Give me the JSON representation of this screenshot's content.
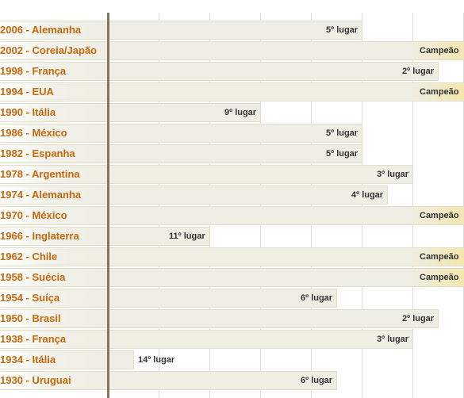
{
  "chart_data": {
    "type": "bar",
    "orientation": "horizontal",
    "title": "",
    "xlabel": "",
    "ylabel": "",
    "value_meaning": "Final placement of team in each World Cup (1 = champion); bar length inversely proportional to placement",
    "xlim_rank": [
      17,
      1
    ],
    "grid": true,
    "legend": "none",
    "colors": {
      "row_label": "#c8660c",
      "place_label": "#333333",
      "bar_fill": "#eeeee4",
      "bar_border": "#dfdfc9",
      "champion_highlight": "#f4e6b0",
      "axis": "#857560",
      "grid": "#dcdcdc"
    },
    "categories": [
      "2006 - Alemanha",
      "2002 - Coreia/Japão",
      "1998 - França",
      "1994 - EUA",
      "1990 - Itália",
      "1986 - México",
      "1982 - Espanha",
      "1978 - Argentina",
      "1974 - Alemanha",
      "1970 - México",
      "1966 - Inglaterra",
      "1962 - Chile",
      "1958 - Suécia",
      "1954 - Suíça",
      "1950 - Brasil",
      "1938 - França",
      "1934 - Itália",
      "1930 - Uruguai"
    ],
    "values": [
      5,
      1,
      2,
      1,
      9,
      5,
      5,
      3,
      4,
      1,
      11,
      1,
      1,
      6,
      2,
      3,
      14,
      6
    ],
    "labels": [
      "5º lugar",
      "Campeão",
      "2º lugar",
      "Campeão",
      "9º lugar",
      "5º lugar",
      "5º lugar",
      "3º lugar",
      "4º lugar",
      "Campeão",
      "11º lugar",
      "Campeão",
      "Campeão",
      "6º lugar",
      "2º lugar",
      "3º lugar",
      "14º lugar",
      "6º lugar"
    ]
  }
}
